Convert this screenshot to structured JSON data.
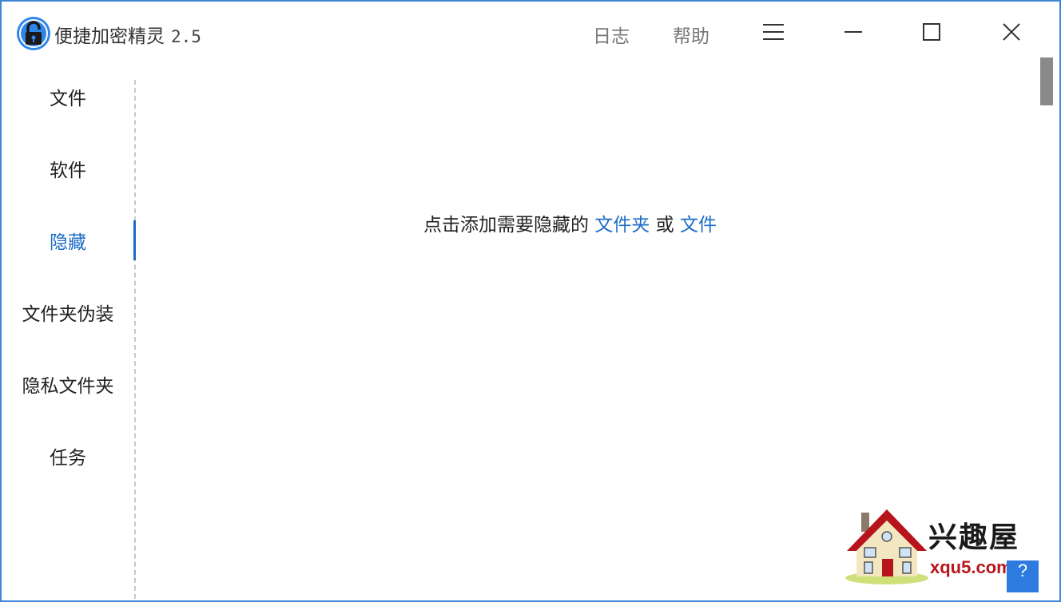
{
  "titlebar": {
    "app_name": "便捷加密精灵",
    "version": "2.5",
    "log_label": "日志",
    "help_label": "帮助"
  },
  "sidebar": {
    "items": [
      {
        "label": "文件"
      },
      {
        "label": "软件"
      },
      {
        "label": "隐藏"
      },
      {
        "label": "文件夹伪装"
      },
      {
        "label": "隐私文件夹"
      },
      {
        "label": "任务"
      }
    ]
  },
  "main": {
    "hint_prefix": "点击添加需要隐藏的",
    "link_folder": "文件夹",
    "hint_or": "或",
    "link_file": "文件"
  },
  "watermark": {
    "site_name": "兴趣屋",
    "site_url": "xqu5.com"
  },
  "help_corner": "?",
  "colors": {
    "accent": "#1c6cc7",
    "window_border": "#3f86d6",
    "icon_blue": "#2f86e8"
  },
  "icons": {
    "app": "lock-icon",
    "menu": "hamburger-icon",
    "minimize": "minimize-icon",
    "maximize": "maximize-icon",
    "close": "close-icon"
  }
}
